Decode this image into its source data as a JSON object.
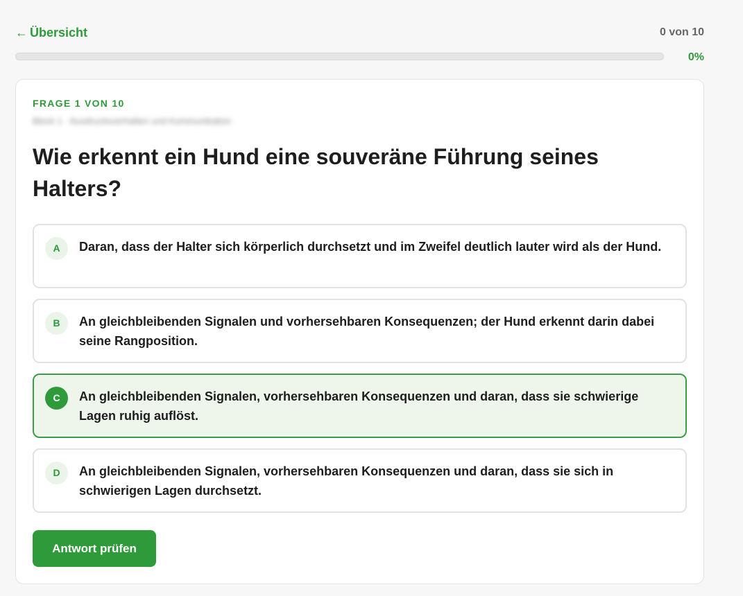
{
  "nav": {
    "back_arrow": "←",
    "back_label": "Übersicht",
    "counter": "0 von 10"
  },
  "progress": {
    "fraction": 0,
    "label": "0%"
  },
  "question": {
    "eyebrow": "FRAGE 1 VON 10",
    "category_blurred": "Block 1 · Ausdrucksverhalten und Kommunikation",
    "text": "Wie erkennt ein Hund eine souveräne Führung seines Halters?"
  },
  "options": [
    {
      "letter": "A",
      "text": "Daran, dass der Halter sich körperlich durchsetzt und im Zweifel deutlich lauter wird als der Hund.",
      "selected": false
    },
    {
      "letter": "B",
      "text": "An gleichbleibenden Signalen und vorhersehbaren Konsequenzen; der Hund erkennt darin dabei seine Rangposition.",
      "selected": false
    },
    {
      "letter": "C",
      "text": "An gleichbleibenden Signalen, vorhersehbaren Konsequenzen und daran, dass sie schwierige Lagen ruhig auflöst.",
      "selected": true
    },
    {
      "letter": "D",
      "text": "An gleichbleibenden Signalen, vorhersehbaren Konsequenzen und daran, dass sie sich in schwierigen Lagen durchsetzt.",
      "selected": false
    }
  ],
  "actions": {
    "submit_label": "Antwort prüfen"
  },
  "colors": {
    "accent": "#2e9a3a",
    "selected_bg": "#eef6ec",
    "border": "#e2e2e2"
  }
}
